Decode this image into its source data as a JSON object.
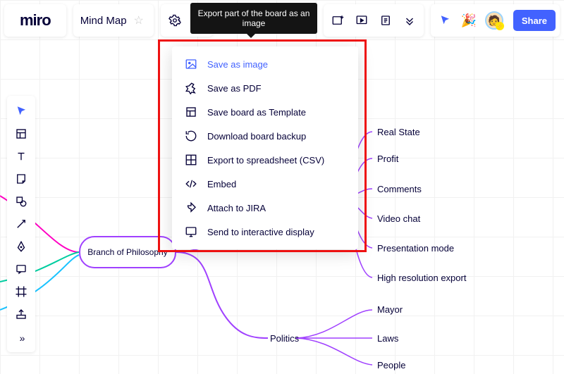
{
  "app": {
    "logo_text": "miro",
    "board_title": "Mind Map"
  },
  "tooltip": "Export part of the board as an image",
  "share_label": "Share",
  "export_menu": [
    {
      "id": "save-image",
      "label": "Save as image",
      "active": true
    },
    {
      "id": "save-pdf",
      "label": "Save as PDF",
      "active": false
    },
    {
      "id": "save-template",
      "label": "Save board as Template",
      "active": false
    },
    {
      "id": "download-backup",
      "label": "Download board backup",
      "active": false
    },
    {
      "id": "export-csv",
      "label": "Export to spreadsheet (CSV)",
      "active": false
    },
    {
      "id": "embed",
      "label": "Embed",
      "active": false
    },
    {
      "id": "attach-jira",
      "label": "Attach to JIRA",
      "active": false
    },
    {
      "id": "send-display",
      "label": "Send to interactive display",
      "active": false
    }
  ],
  "root_node": "Branch of  Philosophy",
  "child_politics": "Politics",
  "right_nodes": [
    "Real State",
    "Profit",
    "Comments",
    "Video chat",
    "Presentation mode",
    "High resolution export"
  ],
  "politics_children": [
    "Mayor",
    "Laws",
    "People"
  ]
}
